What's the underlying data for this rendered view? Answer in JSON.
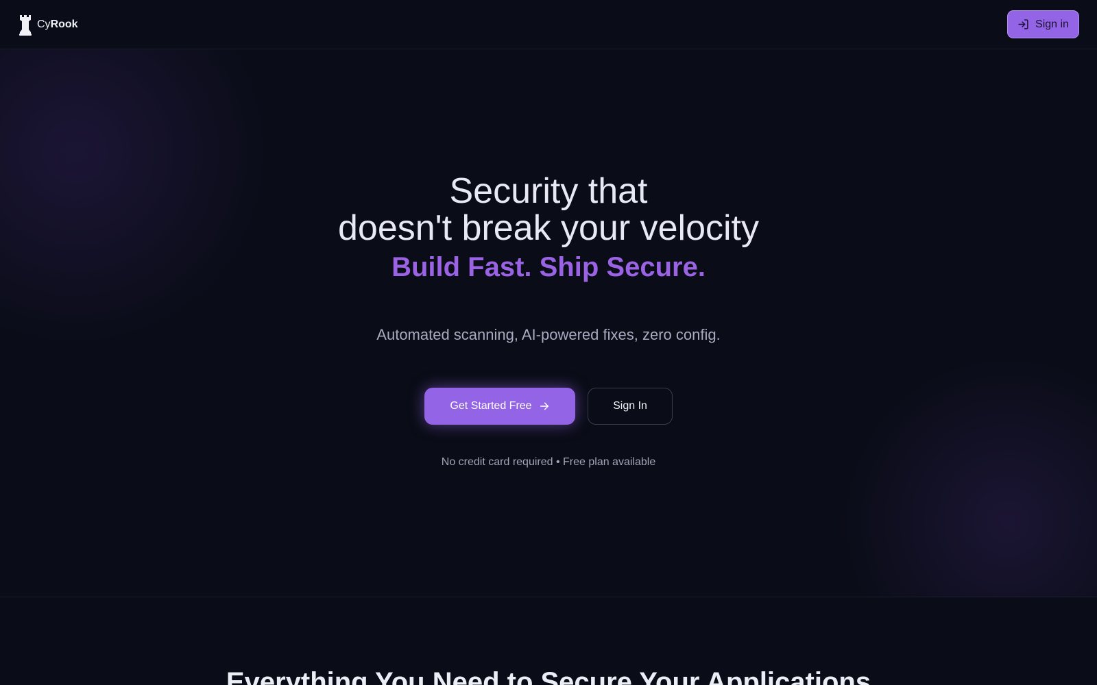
{
  "header": {
    "brand_prefix": "Cy",
    "brand_bold": "Rook",
    "brand_icon": "rook-chess-icon",
    "signin_label": "Sign in",
    "signin_icon": "sign-in-icon"
  },
  "hero": {
    "title_line1": "Security that",
    "title_line2": "doesn't break your velocity",
    "tagline": "Build Fast. Ship Secure.",
    "subtitle": "Automated scanning, AI-powered fixes, zero config.",
    "primary_cta": "Get Started Free",
    "primary_cta_icon": "arrow-right-icon",
    "secondary_cta": "Sign In",
    "note": "No credit card required • Free plan available"
  },
  "features": {
    "title": "Everything You Need to Secure Your Applications"
  },
  "colors": {
    "background": "#0a0c17",
    "accent": "#9364e6",
    "tagline": "#9a63e4"
  }
}
